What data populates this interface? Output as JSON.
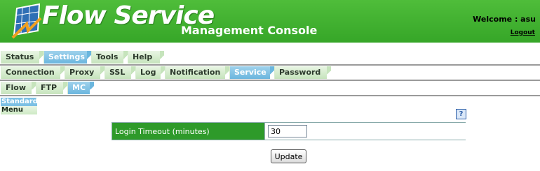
{
  "header": {
    "brand_title": "Flow Service",
    "brand_subtitle": "Management Console",
    "welcome_text": "Welcome : asu",
    "logout_label": "Logout",
    "brand_color": "#3cae2d"
  },
  "tabs_primary": [
    {
      "label": "Status",
      "active": false
    },
    {
      "label": "Settings",
      "active": true
    },
    {
      "label": "Tools",
      "active": false
    },
    {
      "label": "Help",
      "active": false
    }
  ],
  "tabs_secondary": [
    {
      "label": "Connection",
      "active": false
    },
    {
      "label": "Proxy",
      "active": false
    },
    {
      "label": "SSL",
      "active": false
    },
    {
      "label": "Log",
      "active": false
    },
    {
      "label": "Notification",
      "active": false
    },
    {
      "label": "Service",
      "active": true
    },
    {
      "label": "Password",
      "active": false
    }
  ],
  "tabs_tertiary": [
    {
      "label": "Flow",
      "active": false
    },
    {
      "label": "FTP",
      "active": false
    },
    {
      "label": "MC",
      "active": true
    }
  ],
  "side_menu": [
    {
      "label": "Standard",
      "selected": true
    },
    {
      "label": "Menu",
      "selected": false
    }
  ],
  "help_icon": {
    "glyph": "?",
    "icon": "help-icon"
  },
  "form": {
    "field_label": "Login Timeout (minutes)",
    "field_value": "30",
    "label_bg_color": "#2e9a2a"
  },
  "actions": {
    "update_label": "Update"
  },
  "colors": {
    "active_tab": "#6bb6de",
    "inactive_tab": "#c6e4bc"
  }
}
